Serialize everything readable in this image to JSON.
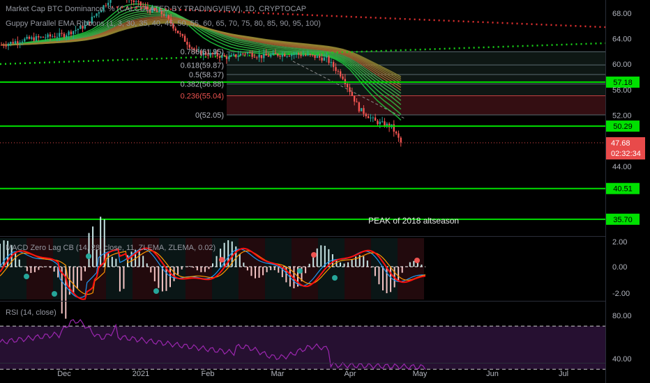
{
  "header": {
    "main_title": "Market Cap BTC Dominance, % (CALCULATED BY TRADINGVIEW), 1D, CRYPTOCAP",
    "ema_title": "Guppy Parallel EMA Ribbons (1, 3, 30, 35, 40, 45, 50, 55, 60, 65, 70, 75, 80, 85, 90, 95, 100)",
    "macd_title": "MACD Zero Lag CB (14, 28, close, 11, ZLEMA, ZLEMA, 0.02)",
    "rsi_title": "RSI (14, close)"
  },
  "annotations": {
    "peak_label": "PEAK of 2018 altseason"
  },
  "price_axis": {
    "ticks": [
      "68.00",
      "64.00",
      "60.00",
      "56.00",
      "52.00",
      "48.00",
      "44.00"
    ],
    "last_price": "47.68",
    "countdown": "02:32:34"
  },
  "levels": [
    {
      "value": 57.18,
      "label": "57.18"
    },
    {
      "value": 50.29,
      "label": "50.29"
    },
    {
      "value": 40.51,
      "label": "40.51"
    },
    {
      "value": 35.7,
      "label": "35.70"
    }
  ],
  "fibs": [
    {
      "label": "0.786(61.95)",
      "value": 61.95
    },
    {
      "label": "0.618(59.87)",
      "value": 59.87
    },
    {
      "label": "0.5(58.37)",
      "value": 58.37
    },
    {
      "label": "0.382(56.88)",
      "value": 56.88
    },
    {
      "label": "0.236(55.04)",
      "value": 55.04
    },
    {
      "label": "0(52.05)",
      "value": 52.05
    }
  ],
  "macd_axis": {
    "ticks": [
      "2.00",
      "0.00",
      "-2.00"
    ]
  },
  "rsi_axis": {
    "ticks": [
      "80.00",
      "40.00"
    ]
  },
  "time_axis": {
    "labels": [
      "Dec",
      "2021",
      "Feb",
      "Mar",
      "Apr",
      "May",
      "Jun",
      "Jul"
    ]
  },
  "colors": {
    "level_line": "#00e000",
    "last_price_bg": "#e84a4a",
    "down_candle": "#ef5350",
    "up_candle": "#26a69a",
    "macd_red": "#ff1010",
    "rsi_line": "#9c27b0"
  },
  "chart_data": {
    "type": "line",
    "title": "Market Cap BTC Dominance, % (CALCULATED BY TRADINGVIEW), 1D, CRYPTOCAP",
    "x": [
      "2020-11-13",
      "2020-11-22",
      "2020-12-01",
      "2020-12-10",
      "2020-12-19",
      "2020-12-28",
      "2021-01-01",
      "2021-01-08",
      "2021-01-15",
      "2021-01-22",
      "2021-01-29",
      "2021-02-05",
      "2021-02-12",
      "2021-02-19",
      "2021-02-26",
      "2021-03-05",
      "2021-03-12",
      "2021-03-19",
      "2021-03-26",
      "2021-04-02",
      "2021-04-09",
      "2021-04-16",
      "2021-04-23",
      "2021-04-30",
      "2021-05-04"
    ],
    "series": [
      {
        "values": [
          63.0,
          63.8,
          64.2,
          64.6,
          66.0,
          69.5,
          71.5,
          70.0,
          68.6,
          67.8,
          64.5,
          61.8,
          61.5,
          61.0,
          61.8,
          61.2,
          61.5,
          61.6,
          61.3,
          60.8,
          58.0,
          53.0,
          51.0,
          50.2,
          47.68
        ]
      }
    ],
    "ylim": [
      33.5,
      69.5
    ],
    "y_ticks": [
      68,
      64,
      60,
      56,
      52,
      48,
      44
    ],
    "levels": [
      57.18,
      50.29,
      40.51,
      35.7
    ],
    "last_value": 47.68,
    "grid": false
  }
}
